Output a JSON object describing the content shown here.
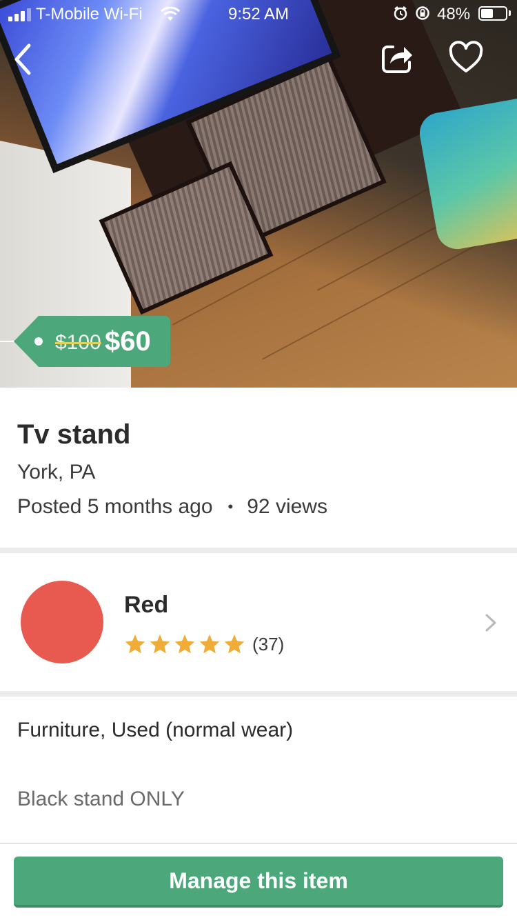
{
  "status_bar": {
    "carrier": "T-Mobile Wi-Fi",
    "time": "9:52 AM",
    "battery": "48%"
  },
  "price_tag": {
    "original_price": "$100",
    "sale_price": "$60",
    "color": "#4ca77b"
  },
  "listing": {
    "title": "Tv stand",
    "location": "York, PA",
    "posted": "Posted 5 months ago",
    "separator": "•",
    "views": "92 views"
  },
  "seller": {
    "name": "Red",
    "rating_stars": 5,
    "rating_count": "(37)",
    "avatar_color": "#e85a4f",
    "star_color": "#f0ac36"
  },
  "details": {
    "category_condition": "Furniture, Used (normal wear)",
    "description": "Black stand ONLY"
  },
  "actions": {
    "manage_label": "Manage this item",
    "button_color": "#4ca77b"
  },
  "icons": {
    "back": "chevron-left-icon",
    "share": "share-icon",
    "favorite": "heart-icon",
    "seller_chevron": "chevron-right-icon"
  }
}
